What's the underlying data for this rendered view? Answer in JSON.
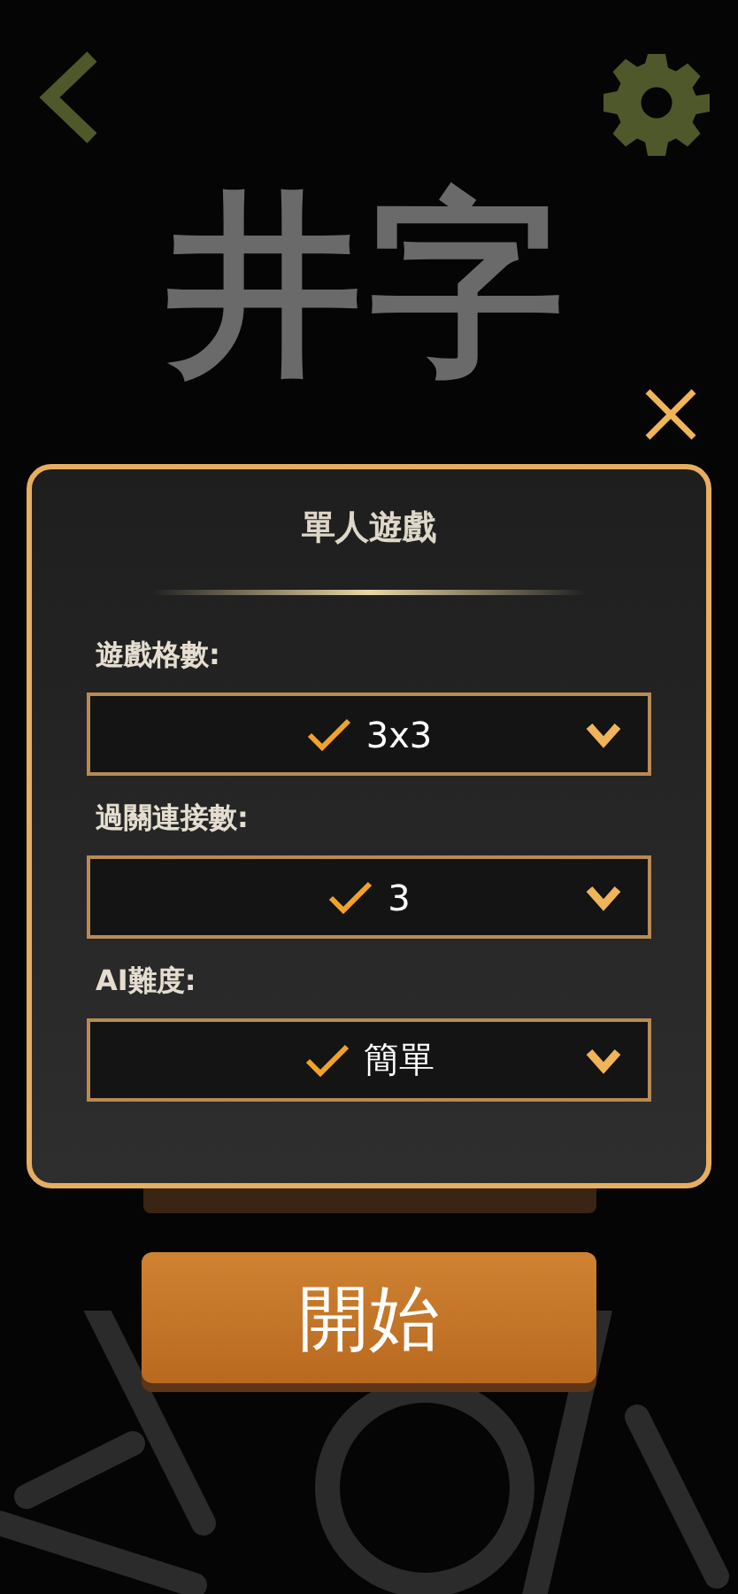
{
  "header": {
    "title": "井字"
  },
  "dialog": {
    "title": "單人遊戲",
    "settings": [
      {
        "label": "遊戲格數:",
        "value": "3x3",
        "checked": true
      },
      {
        "label": "過關連接數:",
        "value": "3",
        "checked": true
      },
      {
        "label": "AI難度:",
        "value": "簡單",
        "checked": true
      }
    ]
  },
  "start_button": {
    "label": "開始"
  }
}
